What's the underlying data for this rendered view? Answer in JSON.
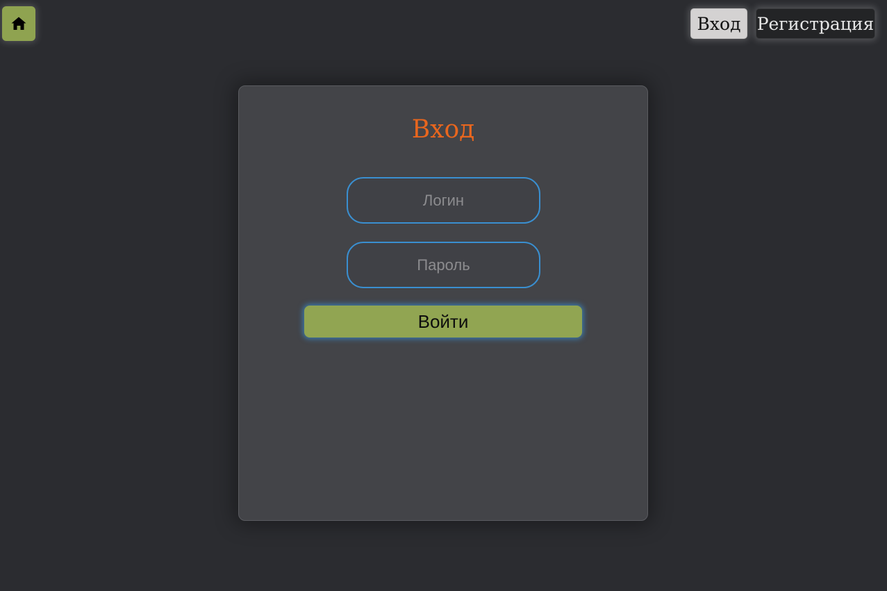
{
  "header": {
    "home_icon": "home-icon",
    "nav": {
      "login_label": "Вход",
      "register_label": "Регистрация"
    }
  },
  "login_form": {
    "title": "Вход",
    "login_placeholder": "Логин",
    "password_placeholder": "Пароль",
    "submit_label": "Войти"
  },
  "colors": {
    "background": "#2b2c30",
    "card": "#434448",
    "accent_green": "#91a552",
    "title_orange": "#e8661e",
    "input_border_blue": "#3a8fd0"
  }
}
